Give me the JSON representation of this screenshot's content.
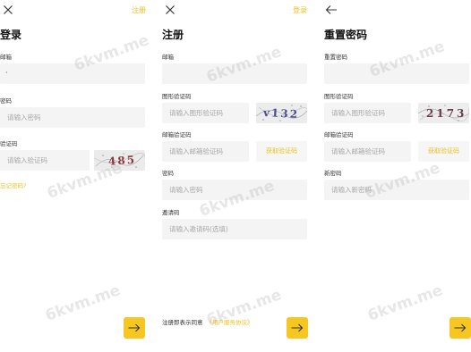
{
  "watermark": "6kvm.me",
  "colors": {
    "accent": "#f7c721",
    "link": "#f2bf1b",
    "field_bg": "#f4f4f4",
    "placeholder": "#a8a8a8"
  },
  "login": {
    "close_icon": "close-icon",
    "top_link": "注册",
    "title": "登录",
    "email_label": "邮箱",
    "email_value": "·",
    "password_label": "密码",
    "password_placeholder": "请输入密码",
    "captcha_label": "验证码",
    "captcha_placeholder": "请输入验证码",
    "captcha_text": "485",
    "forgot_link": "忘记密码?",
    "submit_icon": "arrow-right-icon"
  },
  "register": {
    "close_icon": "close-icon",
    "top_link": "登录",
    "title": "注册",
    "email_label": "邮箱",
    "image_captcha_label": "图形验证码",
    "image_captcha_placeholder": "请输入图形验证码",
    "captcha_text": "v132",
    "email_code_label": "邮箱验证码",
    "email_code_placeholder": "请输入邮箱验证码",
    "send_code": "获取验证码",
    "password_label": "密码",
    "password_placeholder": "请输入密码",
    "invite_label": "邀请码",
    "invite_placeholder": "请输入邀请码(选填)",
    "agree_text": "注册即表示同意",
    "agreement_link": "《用户服务协议》",
    "submit_icon": "arrow-right-icon"
  },
  "reset": {
    "back_icon": "arrow-left-icon",
    "title": "重置密码",
    "email_label": "重置密码",
    "image_captcha_label": "图形验证码",
    "image_captcha_placeholder": "请输入图形验证码",
    "captcha_text": "2173",
    "email_code_label": "邮箱验证码",
    "email_code_placeholder": "请输入邮箱验证码",
    "send_code": "获取验证码",
    "new_password_label": "新密码",
    "new_password_placeholder": "请输入新密码",
    "submit_icon": "arrow-right-icon"
  }
}
